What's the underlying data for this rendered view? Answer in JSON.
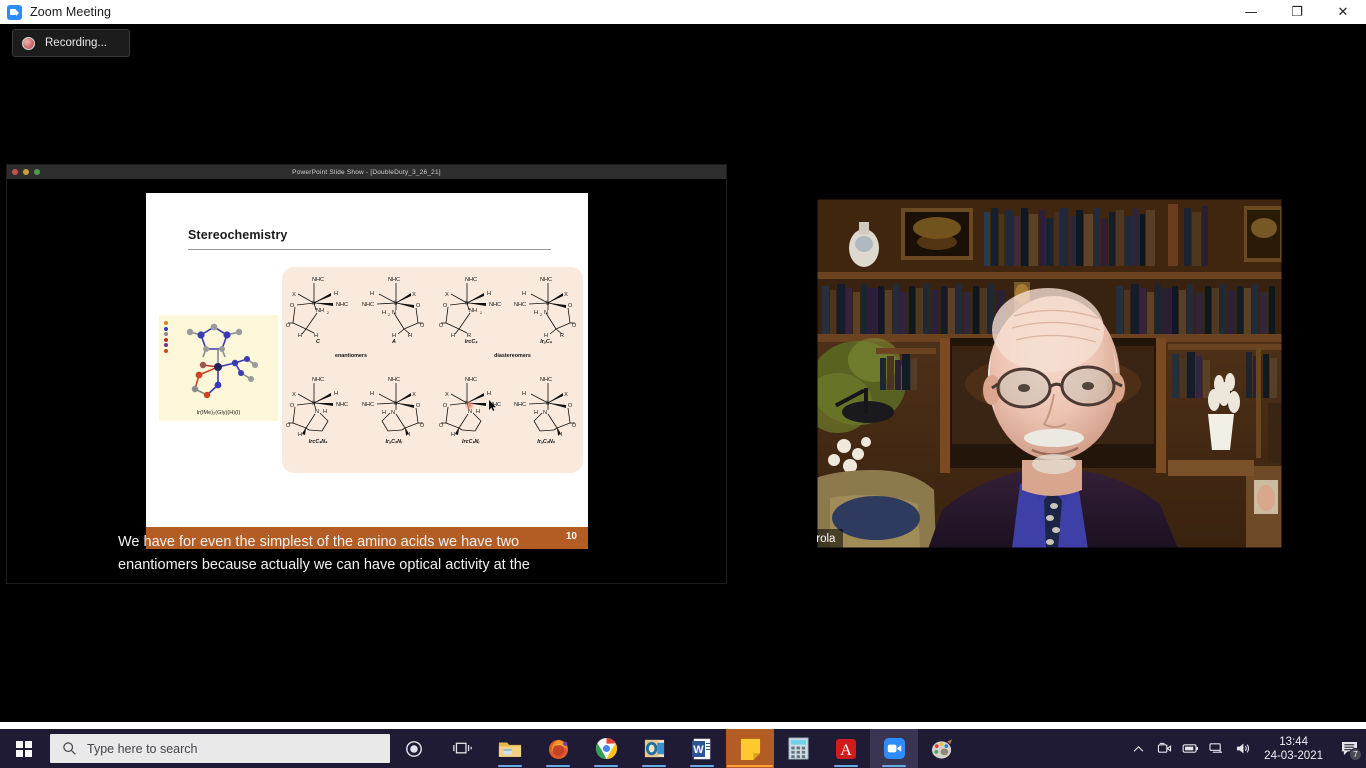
{
  "zoom_window": {
    "title": "Zoom Meeting",
    "app_icon": "zoom-camera-icon",
    "controls": {
      "minimize": "—",
      "restore": "❐",
      "close": "✕"
    },
    "recording": {
      "label": "Recording...",
      "indicator": "record-dot-icon"
    }
  },
  "shared_screen": {
    "window_title": "PowerPoint Slide Show - [DoubleDuty_3_26_21]",
    "traffic_lights": [
      "close-red-dot",
      "minimize-yellow-dot",
      "zoom-green-dot"
    ],
    "slide": {
      "title": "Stereochemistry",
      "slide_number": "10",
      "model_caption": "Ir(IMe)₂(Gly)(H)(I)",
      "top_row": [
        {
          "label": "C"
        },
        {
          "label": "A"
        },
        {
          "label": "IrᴄCₛ"
        },
        {
          "label": "IrₐCₛ"
        }
      ],
      "top_group_labels": [
        {
          "label": "enantiomers"
        },
        {
          "label": "diastereomers"
        }
      ],
      "bottom_row": [
        {
          "label": "IrᴄCₛNₛ"
        },
        {
          "label": "IrₐCₛNᵣ"
        },
        {
          "label": "IrᴄCₛNᵣ"
        },
        {
          "label": "IrₐCₛNₛ"
        }
      ],
      "atom_labels": {
        "nhc": "NHC",
        "x": "X",
        "h": "H",
        "o": "O",
        "nh2": "NH₂",
        "n": "N",
        "r": "R",
        "ir": "Ir"
      },
      "colors": {
        "panel_bg": "#faeade",
        "model_bg": "#fcf7d9",
        "footer_bar": "#b35c23",
        "slide_bg": "#ffffff"
      },
      "pointer": {
        "laser": "laser-pointer-dot",
        "cursor": "mouse-cursor"
      }
    },
    "caption_lines": [
      "We have for even the simplest of the amino acids we have two",
      "enantiomers because actually we can have optical activity at the"
    ]
  },
  "video": {
    "participant_name": "Joseph Merola",
    "audio_icon": "signal-bars-icon"
  },
  "taskbar": {
    "start": "windows-start-icon",
    "search_placeholder": "Type here to search",
    "search_icon": "search-icon",
    "cortana_icon": "cortana-circle-icon",
    "task_view_icon": "task-view-icon",
    "apps": [
      {
        "name": "file-explorer",
        "label": "File Explorer"
      },
      {
        "name": "firefox",
        "label": "Firefox"
      },
      {
        "name": "chrome",
        "label": "Google Chrome"
      },
      {
        "name": "outlook",
        "label": "Outlook"
      },
      {
        "name": "word",
        "label": "Microsoft Word"
      },
      {
        "name": "sticky-notes",
        "label": "Sticky Notes"
      },
      {
        "name": "calculator",
        "label": "Calculator"
      },
      {
        "name": "acrobat",
        "label": "Adobe Acrobat"
      },
      {
        "name": "zoom",
        "label": "Zoom"
      },
      {
        "name": "paint",
        "label": "Paint 3D"
      }
    ],
    "tray": {
      "show_hidden_icons": "chevron-up-icon",
      "icons": [
        "camera-icon",
        "battery-icon",
        "network-icon",
        "volume-icon"
      ],
      "time": "13:44",
      "date": "24-03-2021",
      "notification_icon": "action-center-icon",
      "notification_count": "7"
    }
  }
}
